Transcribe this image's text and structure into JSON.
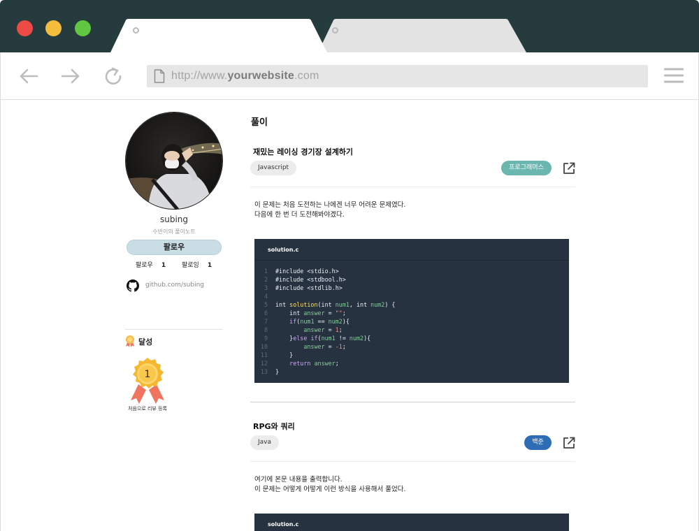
{
  "browser": {
    "url_prefix": "http://www.",
    "url_domain": "yourwebsite",
    "url_suffix": ".com",
    "tabs": [
      {
        "label": ""
      },
      {
        "label": ""
      }
    ],
    "icons": [
      "back-arrow-icon",
      "forward-arrow-icon",
      "reload-icon",
      "page-icon",
      "hamburger-menu-icon"
    ]
  },
  "profile": {
    "username": "subing",
    "subtitle": "수빈이의 풀이노트",
    "follow_label": "팔로우",
    "followers_label": "팔로우",
    "followers_count": "1",
    "following_label": "팔로잉",
    "following_count": "1",
    "github_link": "github.com/subing",
    "achievements_title": "달성",
    "medal_number": "1",
    "medal_label": "처음으로 리뷰 등록"
  },
  "section": {
    "title": "풀이"
  },
  "posts": [
    {
      "title": "재밌는 레이싱 경기장 설계하기",
      "language": "Javascript",
      "source": "프로그래머스",
      "source_color": "#6bb6ae",
      "body_line1": "이 문제는 처음 도전하는 나에겐 너무 어려운 문제였다.",
      "body_line2": "다음에 한 번 더 도전해봐야겠다.",
      "code_filename": "solution.c",
      "code_lines": [
        "#include <stdio.h>",
        "#include <stdbool.h>",
        "#include <stdlib.h>",
        "",
        "int solution(int num1, int num2) {",
        "    int answer = \"\";",
        "    if(num1 == num2){",
        "        answer = 1;",
        "    }else if(num1 != num2){",
        "        answer = -1;",
        "    }",
        "    return answer;",
        "}"
      ]
    },
    {
      "title": "RPG와 쿼리",
      "language": "Java",
      "source": "백준",
      "source_color": "#2f6cb6",
      "body_line1": "여기에 본문 내용을 출력합니다.",
      "body_line2": "이 문제는 어떻게 어떻게 이런 방식을 사용해서 풀었다.",
      "code_filename": "solution.c"
    }
  ]
}
